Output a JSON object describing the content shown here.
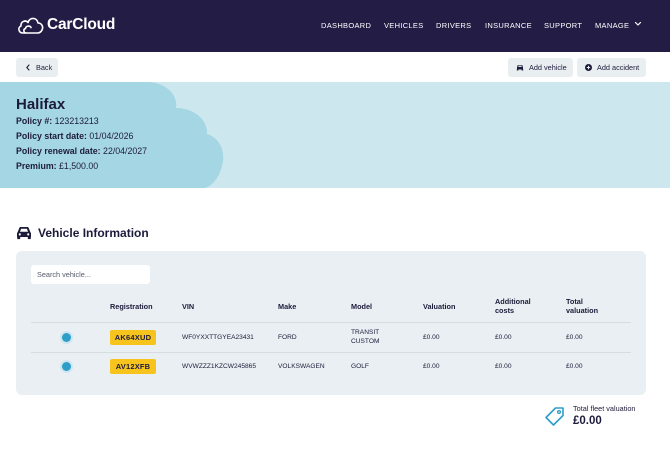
{
  "brand": {
    "name": "CarCloud"
  },
  "nav": {
    "items": [
      {
        "label": "DASHBOARD"
      },
      {
        "label": "VEHICLES"
      },
      {
        "label": "DRIVERS"
      },
      {
        "label": "INSURANCE"
      },
      {
        "label": "SUPPORT"
      },
      {
        "label": "MANAGE"
      }
    ]
  },
  "actions": {
    "back_label": "Back",
    "add_vehicle_label": "Add vehicle",
    "add_accident_label": "Add accident"
  },
  "policy": {
    "title": "Halifax",
    "number_label": "Policy #:",
    "number": "123213213",
    "start_label": "Policy start date:",
    "start": "01/04/2026",
    "renewal_label": "Policy renewal date:",
    "renewal": "22/04/2027",
    "premium_label": "Premium:",
    "premium": "£1,500.00"
  },
  "vehicles": {
    "title": "Vehicle Information",
    "search_placeholder": "Search vehicle...",
    "columns": {
      "registration": "Registration",
      "vin": "VIN",
      "make": "Make",
      "model": "Model",
      "valuation": "Valuation",
      "additional_1": "Additional",
      "additional_2": "costs",
      "total_1": "Total",
      "total_2": "valuation"
    },
    "rows": [
      {
        "registration": "AK64XUD",
        "vin": "WF0YXXTTGYEA23431",
        "make": "FORD",
        "model_1": "TRANSIT",
        "model_2": "CUSTOM",
        "valuation": "£0.00",
        "additional": "£0.00",
        "total": "£0.00"
      },
      {
        "registration": "AV12XFB",
        "vin": "WVWZZZ1KZCW245865",
        "make": "VOLKSWAGEN",
        "model_1": "GOLF",
        "model_2": "",
        "valuation": "£0.00",
        "additional": "£0.00",
        "total": "£0.00"
      }
    ]
  },
  "fleet_total": {
    "label": "Total fleet valuation",
    "value": "£0.00"
  },
  "colors": {
    "nav_bg": "#231d46",
    "hero_bg": "#cde7ef",
    "cloud": "#a5d6e3",
    "plate": "#f7c41d",
    "radio": "#2e9ec9",
    "accent_icon": "#2e9ec9"
  }
}
